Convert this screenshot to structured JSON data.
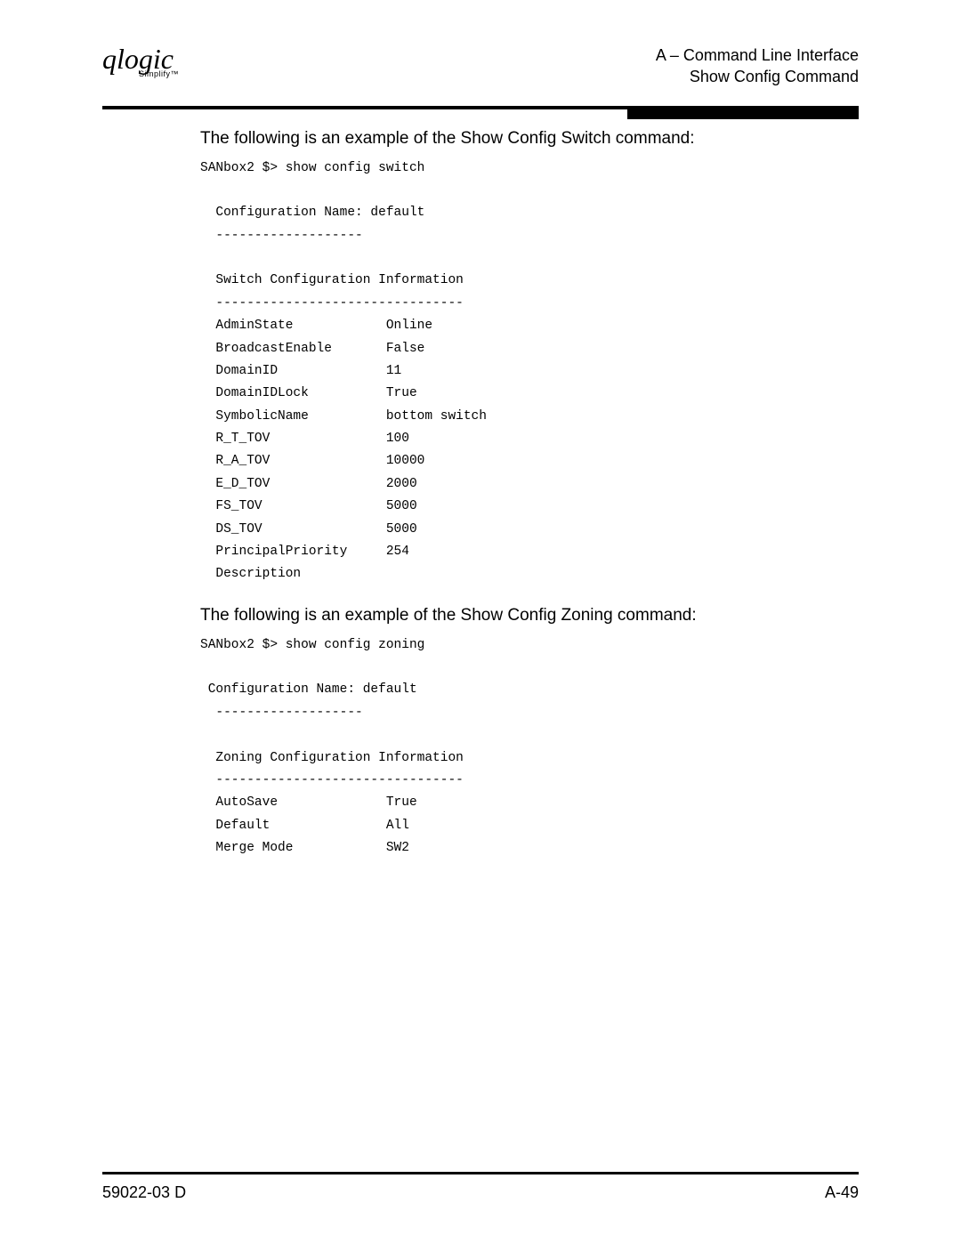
{
  "header": {
    "logo_text": "qlogic",
    "logo_sub": "Simplify™",
    "title_top": "A – Command Line Interface",
    "title_bottom": "Show Config Command"
  },
  "section1": {
    "lead": "The following is an example of the Show Config Switch command:",
    "terminal": "SANbox2 $> show config switch\n\n  Configuration Name: default\n  -------------------\n\n  Switch Configuration Information\n  --------------------------------\n  AdminState            Online\n  BroadcastEnable       False\n  DomainID              11\n  DomainIDLock          True\n  SymbolicName          bottom switch\n  R_T_TOV               100\n  R_A_TOV               10000\n  E_D_TOV               2000\n  FS_TOV                5000\n  DS_TOV                5000\n  PrincipalPriority     254\n  Description"
  },
  "section2": {
    "lead": "The following is an example of the Show Config Zoning command:",
    "terminal": "SANbox2 $> show config zoning\n\n Configuration Name: default\n  -------------------\n\n  Zoning Configuration Information\n  --------------------------------\n  AutoSave              True\n  Default               All\n  Merge Mode            SW2"
  },
  "footer": {
    "left": "59022-03  D",
    "right": "A-49"
  }
}
